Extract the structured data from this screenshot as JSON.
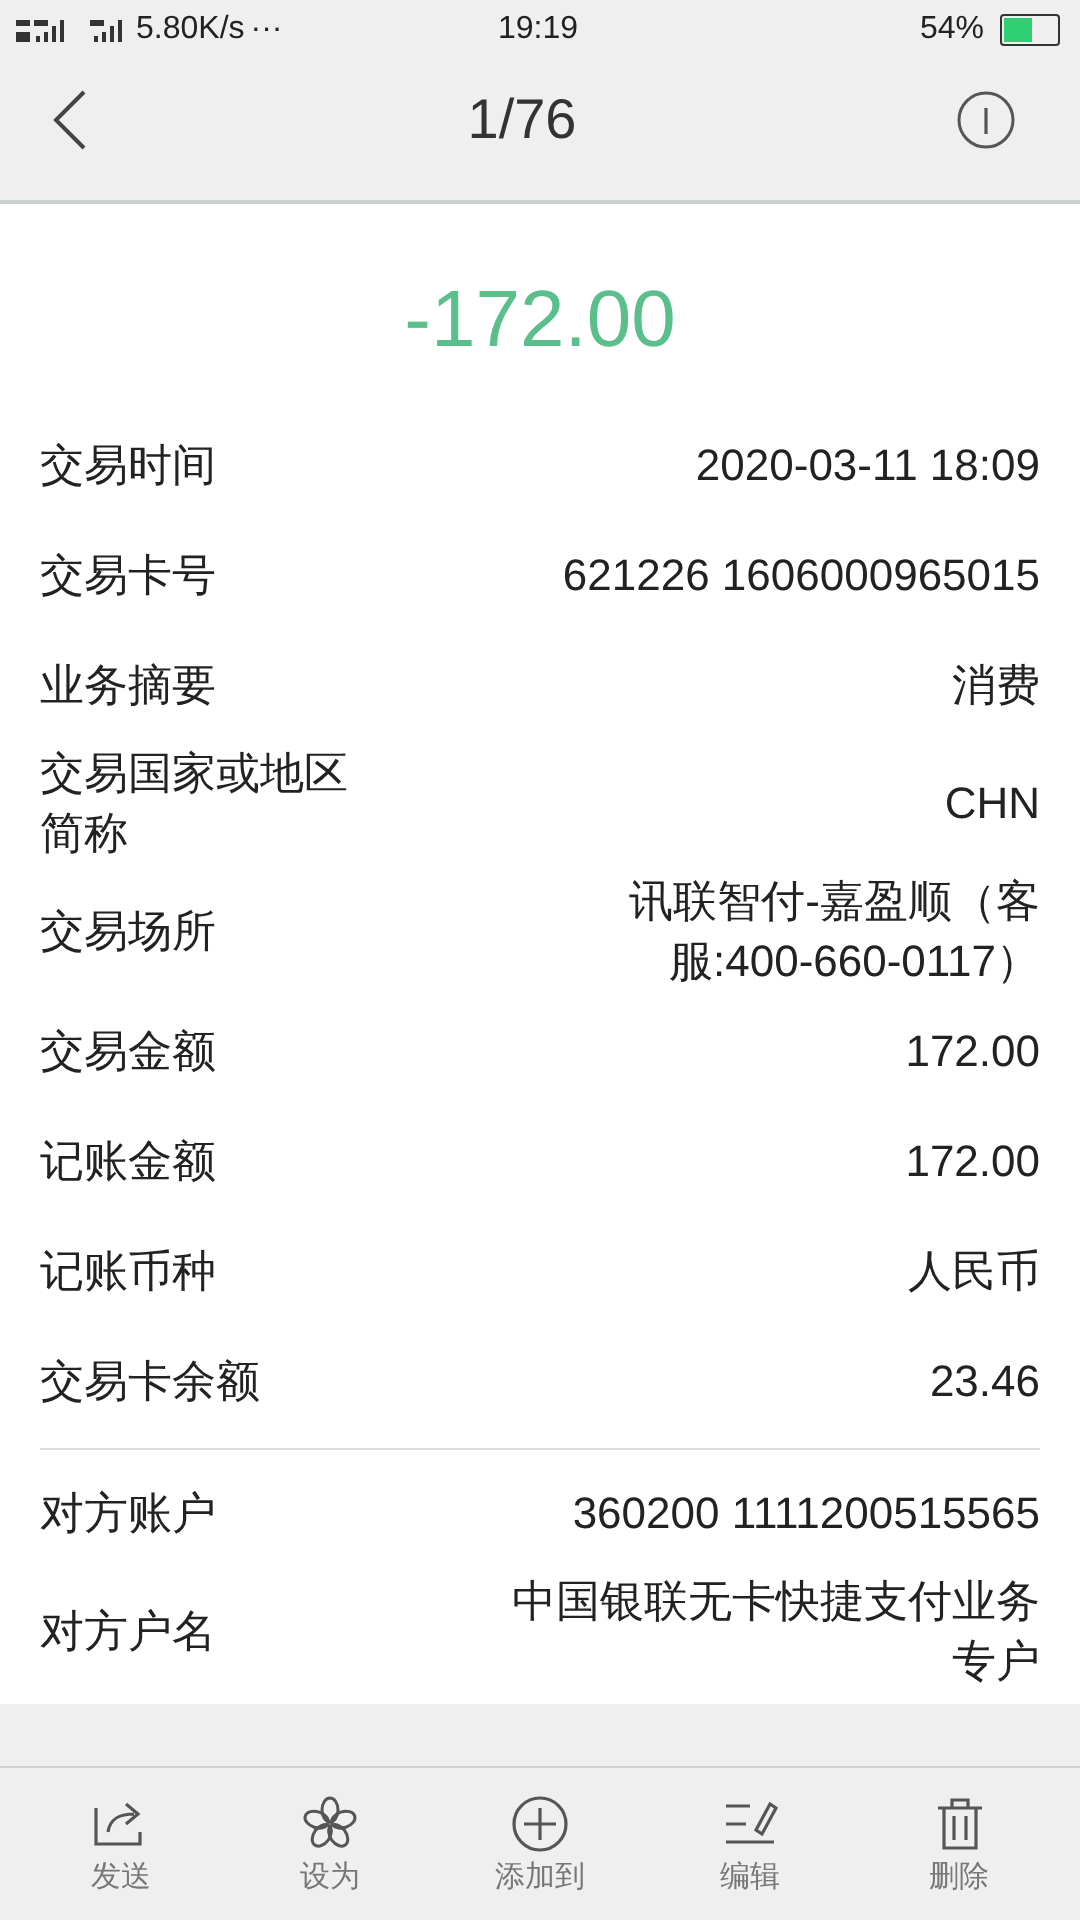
{
  "status_bar": {
    "network": "5.80K/s",
    "more": "···",
    "time": "19:19",
    "battery_text": "54%"
  },
  "header": {
    "title": "1/76"
  },
  "amount": "-172.00",
  "sections": [
    {
      "rows": [
        {
          "label": "交易时间",
          "value": "2020-03-11 18:09"
        },
        {
          "label": "交易卡号",
          "value": "621226 1606000965015"
        },
        {
          "label": "业务摘要",
          "value": "消费"
        },
        {
          "label": "交易国家或地区简称",
          "value": "CHN"
        },
        {
          "label": "交易场所",
          "value": "讯联智付-嘉盈顺（客服:400-660-0117）"
        },
        {
          "label": "交易金额",
          "value": "172.00"
        },
        {
          "label": "记账金额",
          "value": "172.00"
        },
        {
          "label": "记账币种",
          "value": "人民币"
        },
        {
          "label": "交易卡余额",
          "value": "23.46"
        }
      ]
    },
    {
      "rows": [
        {
          "label": "对方账户",
          "value": "360200 1111200515565"
        },
        {
          "label": "对方户名",
          "value": "中国银联无卡快捷支付业务专户"
        }
      ]
    }
  ],
  "toolbar": [
    {
      "kind": "send",
      "label": "发送"
    },
    {
      "kind": "set",
      "label": "设为"
    },
    {
      "kind": "add",
      "label": "添加到"
    },
    {
      "kind": "edit",
      "label": "编辑"
    },
    {
      "kind": "delete",
      "label": "删除"
    }
  ]
}
